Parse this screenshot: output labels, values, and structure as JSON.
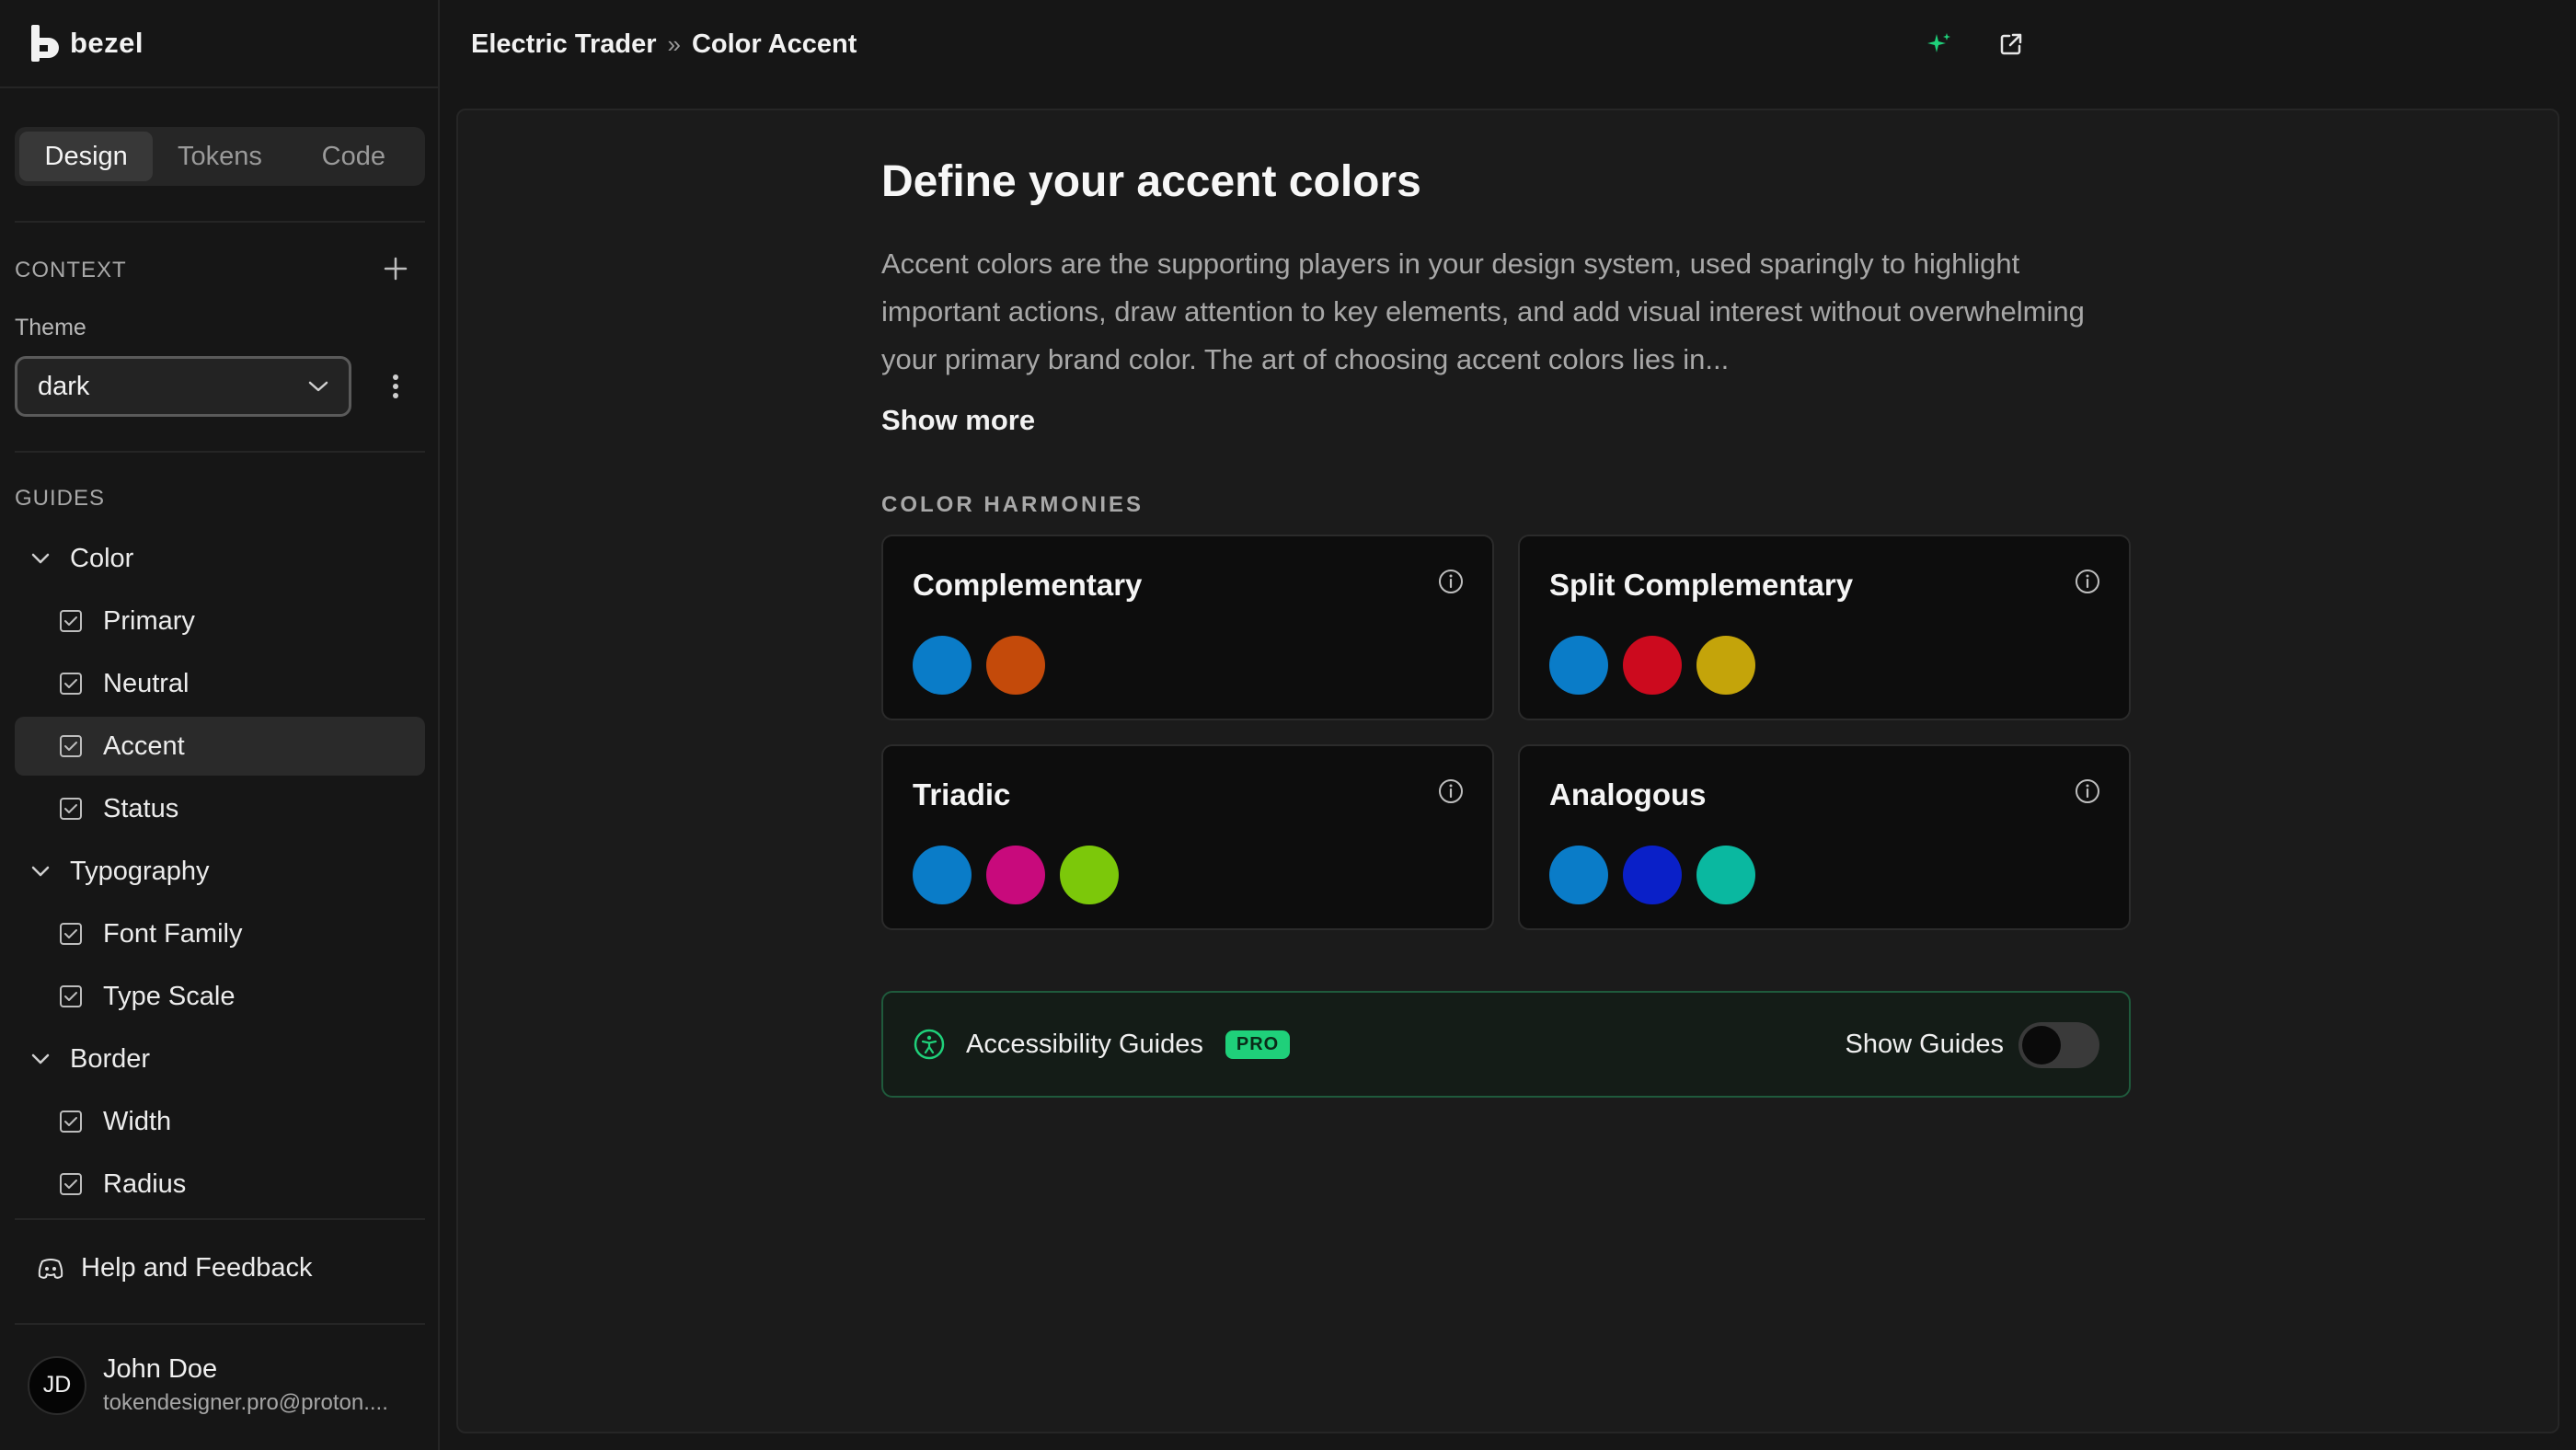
{
  "brand": {
    "name": "bezel",
    "icon": "bezel-logo"
  },
  "sidebar": {
    "tabs": [
      {
        "label": "Design",
        "active": true
      },
      {
        "label": "Tokens",
        "active": false
      },
      {
        "label": "Code",
        "active": false
      }
    ],
    "context_label": "CONTEXT",
    "theme_label": "Theme",
    "theme_value": "dark",
    "guides_label": "GUIDES",
    "tree": [
      {
        "type": "group",
        "label": "Color",
        "expanded": true
      },
      {
        "type": "item",
        "label": "Primary",
        "checked": true
      },
      {
        "type": "item",
        "label": "Neutral",
        "checked": true
      },
      {
        "type": "item",
        "label": "Accent",
        "checked": true,
        "selected": true
      },
      {
        "type": "item",
        "label": "Status",
        "checked": true
      },
      {
        "type": "group",
        "label": "Typography",
        "expanded": true
      },
      {
        "type": "item",
        "label": "Font Family",
        "checked": true
      },
      {
        "type": "item",
        "label": "Type Scale",
        "checked": true
      },
      {
        "type": "group",
        "label": "Border",
        "expanded": true
      },
      {
        "type": "item",
        "label": "Width",
        "checked": true
      },
      {
        "type": "item",
        "label": "Radius",
        "checked": true
      }
    ],
    "help_label": "Help and Feedback",
    "user": {
      "initials": "JD",
      "name": "John Doe",
      "email": "tokendesigner.pro@proton...."
    }
  },
  "header": {
    "breadcrumb": [
      "Electric Trader",
      "Color Accent"
    ],
    "breadcrumb_separator": "»"
  },
  "main": {
    "title": "Define your accent colors",
    "description": "Accent colors are the supporting players in your design system, used sparingly to highlight important actions, draw attention to key elements, and add visual interest without overwhelming your primary brand color. The art of choosing accent colors lies in...",
    "show_more": "Show more",
    "harmonies_label": "COLOR HARMONIES",
    "harmonies": [
      {
        "name": "Complementary",
        "colors": [
          "#0a7cc8",
          "#c44a0a"
        ]
      },
      {
        "name": "Split Complementary",
        "colors": [
          "#0a7cc8",
          "#cc0a1e",
          "#c4a40a"
        ]
      },
      {
        "name": "Triadic",
        "colors": [
          "#0a7cc8",
          "#c80a7c",
          "#7cc80a"
        ]
      },
      {
        "name": "Analogous",
        "colors": [
          "#0a7cc8",
          "#0a20c8",
          "#0ab8a0"
        ]
      }
    ],
    "accessibility": {
      "label": "Accessibility Guides",
      "badge": "PRO",
      "toggle_label": "Show Guides",
      "toggle_on": false
    }
  },
  "colors": {
    "accent_green": "#1fd07a",
    "background": "#161616",
    "card_background": "#0d0d0d"
  }
}
